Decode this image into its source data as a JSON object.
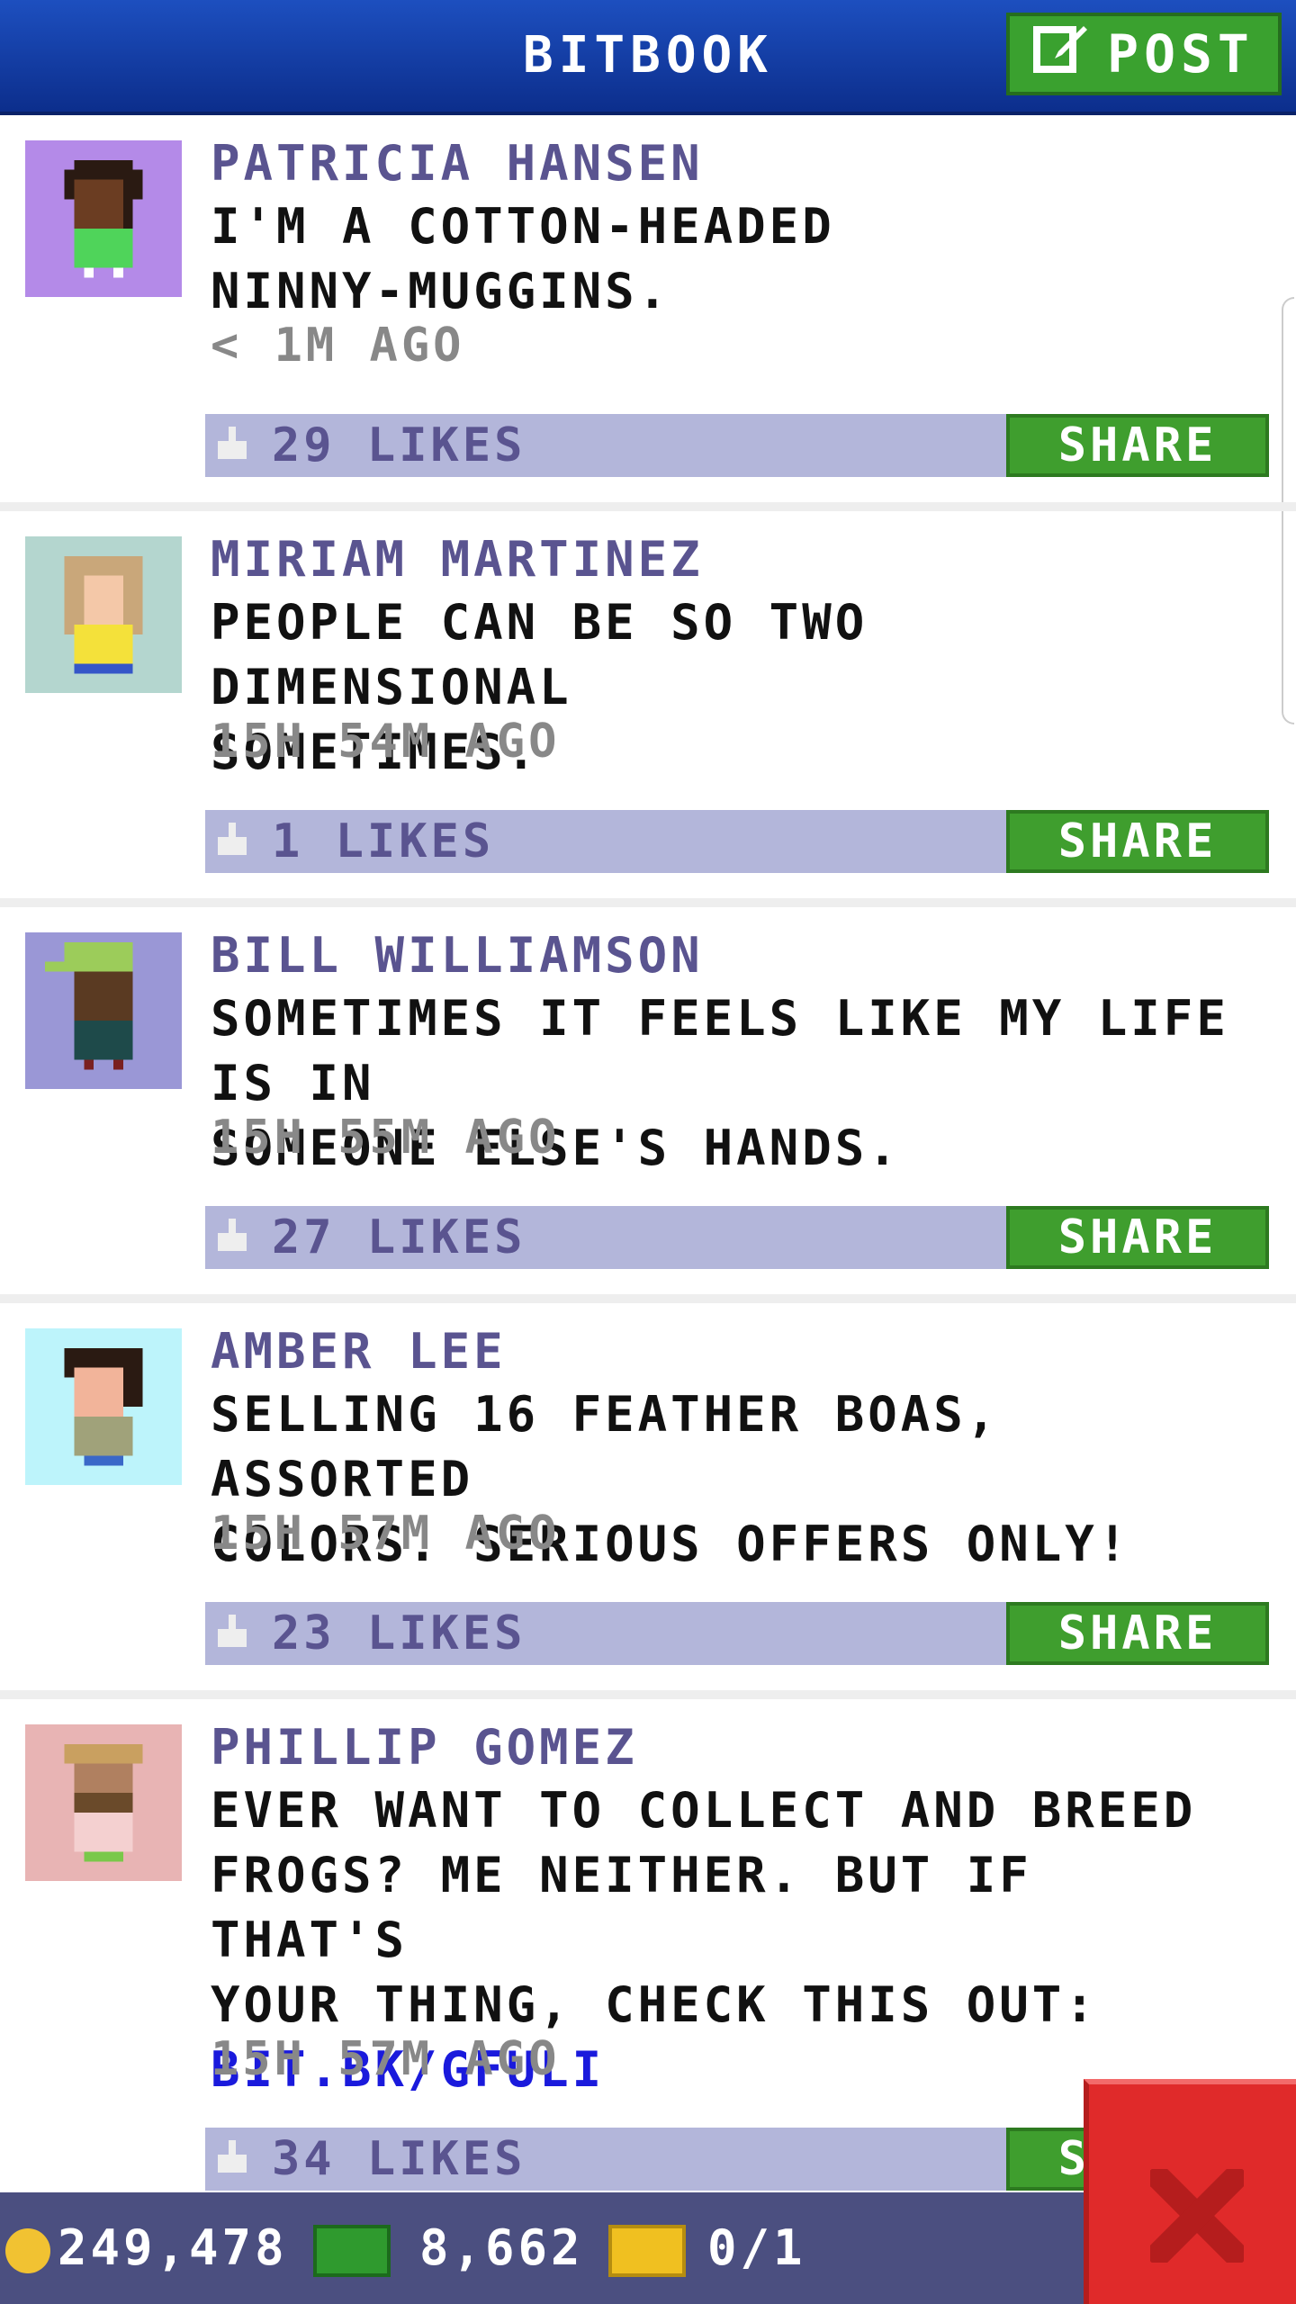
{
  "header": {
    "title": "BITBOOK",
    "post_label": "POST"
  },
  "posts": [
    {
      "name": "PATRICIA HANSEN",
      "text_lines": [
        "I'M A COTTON-HEADED",
        "NINNY-MUGGINS."
      ],
      "time": "< 1M AGO",
      "likes": "29 LIKES",
      "share": "SHARE"
    },
    {
      "name": "MIRIAM MARTINEZ",
      "text_lines": [
        "PEOPLE CAN BE SO TWO DIMENSIONAL",
        "SOMETIMES."
      ],
      "time": "15H 54M AGO",
      "likes": "1 LIKES",
      "share": "SHARE"
    },
    {
      "name": "BILL WILLIAMSON",
      "text_lines": [
        "SOMETIMES IT FEELS LIKE MY LIFE IS IN",
        "SOMEONE ELSE'S HANDS."
      ],
      "time": "15H 55M AGO",
      "likes": "27 LIKES",
      "share": "SHARE"
    },
    {
      "name": "AMBER LEE",
      "text_lines": [
        "SELLING 16 FEATHER BOAS, ASSORTED",
        "COLORS. SERIOUS OFFERS ONLY!"
      ],
      "time": "15H 57M AGO",
      "likes": "23 LIKES",
      "share": "SHARE"
    },
    {
      "name": "PHILLIP GOMEZ",
      "text_lines": [
        "EVER WANT TO COLLECT AND BREED",
        "FROGS? ME NEITHER. BUT IF THAT'S",
        "YOUR THING, CHECK THIS OUT:"
      ],
      "link": "BIT.BK/GFULI",
      "time": "15H 57M AGO",
      "likes": "34 LIKES",
      "share": "SHARE"
    }
  ],
  "footer": {
    "coins": "249,478",
    "bux": "8,662",
    "vip": "0/1"
  },
  "icons": {
    "post": "edit-icon",
    "like": "thumbs-up-icon",
    "coin": "coin-icon",
    "bux": "bux-icon",
    "vip": "vip-ticket-icon",
    "close": "close-icon"
  },
  "colors": {
    "header": "#0c2e8c",
    "share": "#3f9e2e",
    "likebar": "#b3b6da",
    "close": "#e02a2a",
    "footer": "#4b4f80",
    "name": "#5a5490",
    "link": "#1a1adc"
  }
}
